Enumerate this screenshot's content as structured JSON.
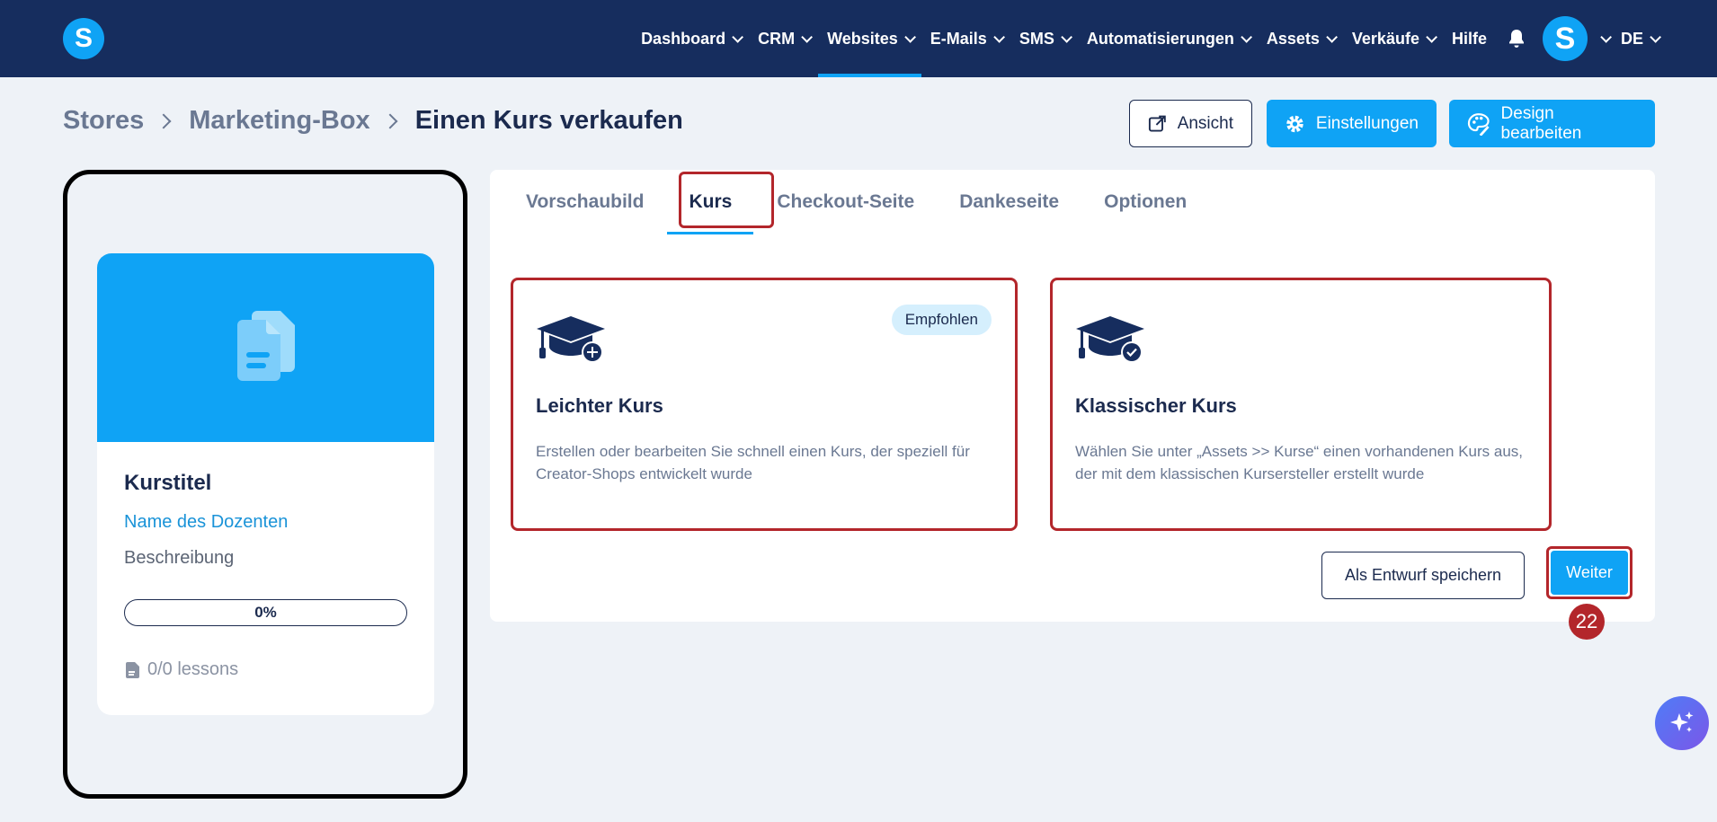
{
  "nav": {
    "logo": "S",
    "items": [
      {
        "label": "Dashboard",
        "dropdown": true,
        "active": false
      },
      {
        "label": "CRM",
        "dropdown": true,
        "active": false
      },
      {
        "label": "Websites",
        "dropdown": true,
        "active": true
      },
      {
        "label": "E-Mails",
        "dropdown": true,
        "active": false
      },
      {
        "label": "SMS",
        "dropdown": true,
        "active": false
      },
      {
        "label": "Automatisierungen",
        "dropdown": true,
        "active": false
      },
      {
        "label": "Assets",
        "dropdown": true,
        "active": false
      },
      {
        "label": "Verkäufe",
        "dropdown": true,
        "active": false
      },
      {
        "label": "Hilfe",
        "dropdown": false,
        "active": false
      }
    ],
    "avatar": "S",
    "language": "DE",
    "colors": {
      "background": "#162d5e",
      "accent": "#0fa3f5"
    }
  },
  "breadcrumb": [
    "Stores",
    "Marketing-Box",
    "Einen Kurs verkaufen"
  ],
  "header_buttons": {
    "view": "Ansicht",
    "settings": "Einstellungen",
    "design": "Design bearbeiten"
  },
  "preview": {
    "title": "Kurstitel",
    "teacher": "Name des Dozenten",
    "description": "Beschreibung",
    "progress": "0%",
    "lessons": "0/0 lessons"
  },
  "tabs": [
    {
      "label": "Vorschaubild",
      "active": false
    },
    {
      "label": "Kurs",
      "active": true
    },
    {
      "label": "Checkout-Seite",
      "active": false
    },
    {
      "label": "Dankeseite",
      "active": false
    },
    {
      "label": "Optionen",
      "active": false
    }
  ],
  "options": [
    {
      "badge": "Empfohlen",
      "title": "Leichter Kurs",
      "description": "Erstellen oder bearbeiten Sie schnell einen Kurs, der speziell für Creator-Shops entwickelt wurde",
      "icon": "graduation-cap-plus-icon"
    },
    {
      "title": "Klassischer Kurs",
      "description": "Wählen Sie unter „Assets >> Kurse“ einen vorhandenen Kurs aus, der mit dem klassischen Kursersteller erstellt wurde",
      "icon": "graduation-cap-check-icon"
    }
  ],
  "actions": {
    "draft": "Als Entwurf speichern",
    "next": "Weiter"
  },
  "step_number": "22",
  "highlight_color": "#b3262b"
}
